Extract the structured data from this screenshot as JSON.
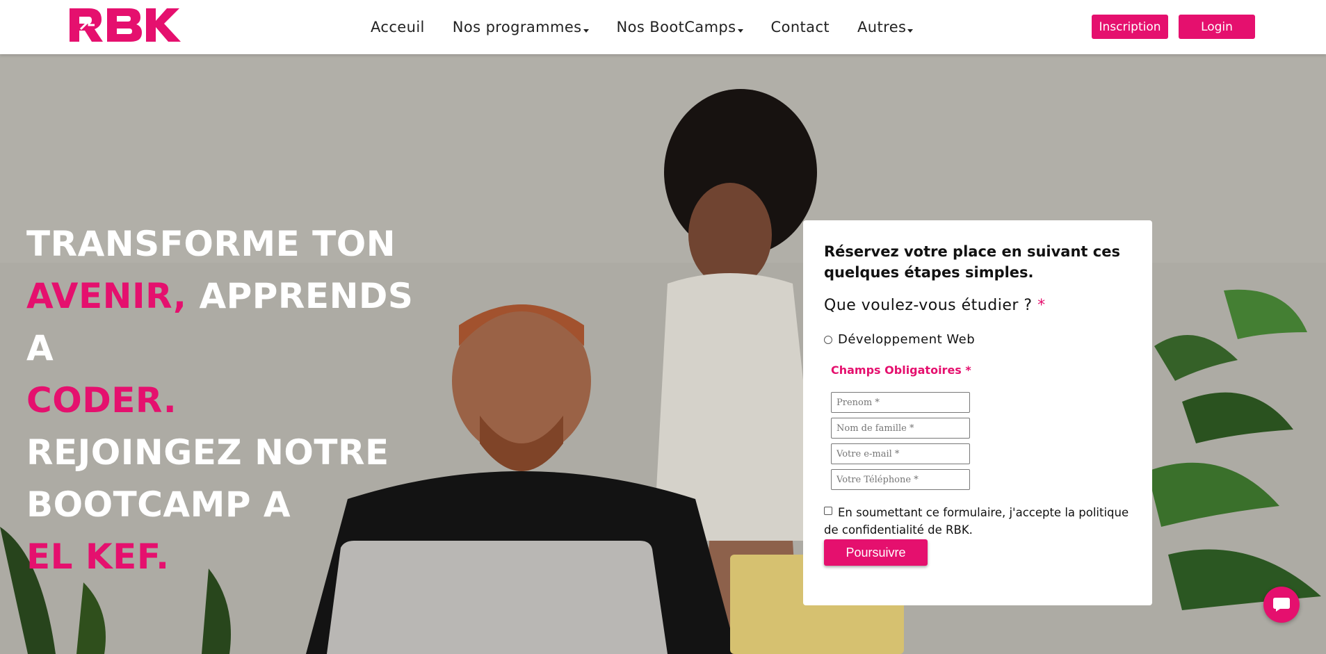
{
  "brand": {
    "logo_text": "RBK",
    "accent": "#e5106e"
  },
  "nav": {
    "items": [
      {
        "label": "Acceuil",
        "has_dropdown": false
      },
      {
        "label": "Nos programmes",
        "has_dropdown": true
      },
      {
        "label": "Nos BootCamps",
        "has_dropdown": true
      },
      {
        "label": "Contact",
        "has_dropdown": false
      },
      {
        "label": "Autres",
        "has_dropdown": true
      }
    ],
    "inscription_label": "Inscription",
    "login_label": "Login"
  },
  "hero": {
    "line1": "TRANSFORME TON",
    "line2_pink": "AVENIR,",
    "line2_white": " APPRENDS A",
    "line3_pink": "CODER.",
    "line4": "REJOINGEZ NOTRE",
    "line5": "BOOTCAMP A",
    "line6_pink": "EL KEF."
  },
  "form": {
    "heading": "Réservez votre place en suivant ces quelques étapes simples.",
    "question": "Que voulez-vous étudier ?",
    "required_mark": "*",
    "option_label": "Développement Web",
    "required_note": "Champs Obligatoires *",
    "fields": {
      "first_name_placeholder": "Prenom *",
      "last_name_placeholder": "Nom de famille *",
      "email_placeholder": "Votre e-mail *",
      "phone_placeholder": "Votre Téléphone *"
    },
    "consent_text": "En soumettant ce formulaire, j'accepte la politique de confidentialité de RBK.",
    "submit_label": "Poursuivre"
  },
  "chat": {
    "icon": "chat-bubble-icon"
  }
}
